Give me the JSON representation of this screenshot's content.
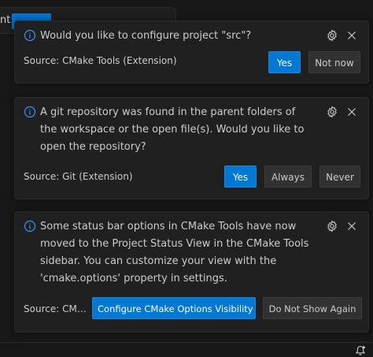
{
  "background_fragment": {
    "text": "nt"
  },
  "notifications": [
    {
      "message": "Would you like to configure project \"src\"?",
      "source": "Source: CMake Tools (Extension)",
      "buttons": [
        "Yes",
        "Not now"
      ]
    },
    {
      "message": "A git repository was found in the parent folders of the workspace or the open file(s). Would you like to open the repository?",
      "source": "Source: Git (Extension)",
      "buttons": [
        "Yes",
        "Always",
        "Never"
      ]
    },
    {
      "message": "Some status bar options in CMake Tools have now moved to the Project Status View in the CMake Tools sidebar. You can customize your view with the 'cmake.options' property in settings.",
      "source": "Source: CMake Tools (Extension)",
      "buttons": [
        "Configure CMake Options Visibility",
        "Do Not Show Again"
      ]
    }
  ],
  "icons": {
    "info": "info-icon",
    "settings": "gear-icon",
    "close": "close-icon",
    "notifications": "bell-icon"
  },
  "colors": {
    "accent": "#0078d4",
    "info_icon": "#3794ff",
    "toast_background": "#202020",
    "secondary_button": "#313131"
  }
}
